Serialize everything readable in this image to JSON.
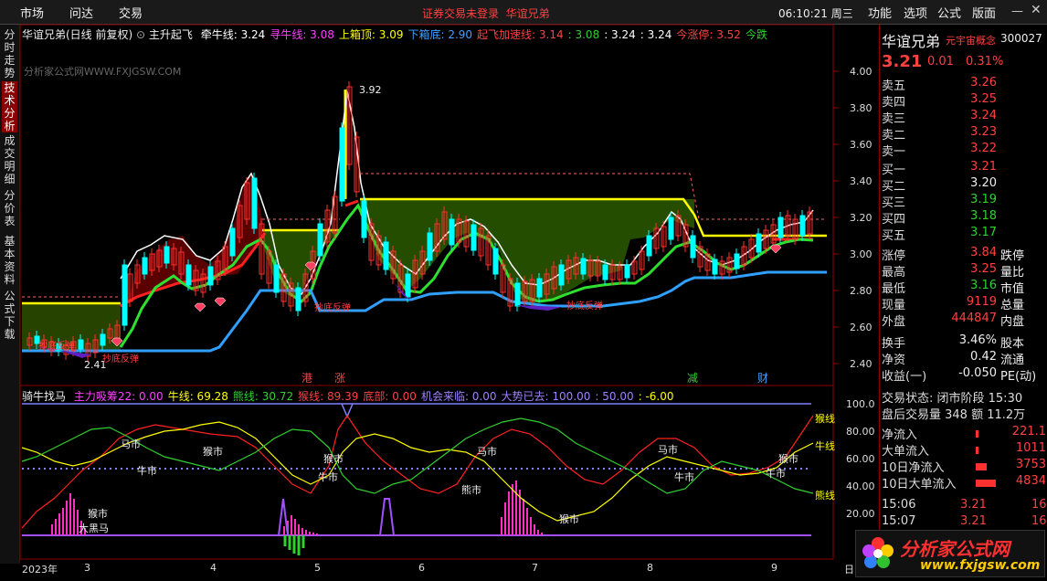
{
  "menu": {
    "items": [
      "市场",
      "问达",
      "交易"
    ],
    "right_items": [
      "功能",
      "选项",
      "公式",
      "版面"
    ],
    "warning": "证券交易未登录",
    "warning_name": "华谊兄弟",
    "clock": "06:10:21 周三"
  },
  "sidebar": {
    "tabs": [
      "分时走势",
      "技术分析",
      "成交明细",
      "分价表",
      "基本资料",
      "公式下载"
    ],
    "active": 1
  },
  "chart": {
    "stock_name": "华谊兄弟(日线 前复权)",
    "formula": "主升起飞",
    "labels": [
      {
        "t": "牵牛线: 3.24",
        "c": "#ffffff"
      },
      {
        "t": "寻牛线: 3.08",
        "c": "#ff40ff"
      },
      {
        "t": "上箱顶: 3.09",
        "c": "#ffff00"
      },
      {
        "t": "下箱底: 2.90",
        "c": "#40a0ff"
      },
      {
        "t": "起飞加速线: 3.14",
        "c": "#ff4040"
      },
      {
        "t": ": 3.08",
        "c": "#30d030"
      },
      {
        "t": ": 3.24",
        "c": "#ffffff"
      },
      {
        "t": ": 3.24",
        "c": "#ffffff"
      },
      {
        "t": "今涨停: 3.52",
        "c": "#ff4040"
      },
      {
        "t": "今跌",
        "c": "#30d030"
      }
    ],
    "watermark": "分析家公式网WWW.FXJGSW.COM",
    "price_ticks": [
      "4.00",
      "3.80",
      "3.60",
      "3.40",
      "3.20",
      "3.00",
      "2.80",
      "2.60",
      "2.40"
    ],
    "peak_label": "3.92",
    "low_label": "2.41",
    "annotations": [
      "抄底反弹",
      "抄底反弹",
      "抄底反弹",
      "抄底反弹"
    ],
    "event_marks": [
      {
        "t": "港",
        "c": "#ff4040"
      },
      {
        "t": "涨",
        "c": "#ff4040"
      },
      {
        "t": "减",
        "c": "#30d030"
      },
      {
        "t": "财",
        "c": "#40a0ff"
      }
    ]
  },
  "indicator": {
    "name": "骑牛找马",
    "labels": [
      {
        "t": "主力吸筹22: 0.00",
        "c": "#ff40ff"
      },
      {
        "t": "牛线: 69.28",
        "c": "#ffff00"
      },
      {
        "t": "熊线: 30.72",
        "c": "#30d030"
      },
      {
        "t": "猴线: 89.39",
        "c": "#ff4040"
      },
      {
        "t": "底部: 0.00",
        "c": "#ff4040"
      },
      {
        "t": "机会来临: 0.00",
        "c": "#a080ff"
      },
      {
        "t": "大势已去: 100.00",
        "c": "#a080ff"
      },
      {
        "t": ": 50.00",
        "c": "#a080ff"
      },
      {
        "t": ": -6.00",
        "c": "#ffff00"
      }
    ],
    "ticks": [
      "100.0",
      "80.00",
      "60.00",
      "40.00",
      "20.00"
    ],
    "right_tags": [
      {
        "t": "猴线",
        "c": "#ffff00"
      },
      {
        "t": "牛线",
        "c": "#ffff00"
      },
      {
        "t": "熊线",
        "c": "#ffff00"
      }
    ],
    "chart_labels": [
      "马市",
      "猴市",
      "牛市",
      "猴市",
      "牛市",
      "马市",
      "熊市",
      "马市",
      "牛市",
      "猴市",
      "牛市",
      "猴市",
      "大黑马",
      "猴市"
    ]
  },
  "xaxis": {
    "labels": [
      "2023年",
      "3",
      "4",
      "5",
      "6",
      "7",
      "8",
      "9",
      "日"
    ]
  },
  "quote": {
    "name": "华谊兄弟",
    "concept": "元宇宙概念",
    "code": "300027",
    "price": "3.21",
    "change": "0.01",
    "pct": "0.31%",
    "asks": [
      {
        "l": "卖五",
        "v": "3.26"
      },
      {
        "l": "卖四",
        "v": "3.25"
      },
      {
        "l": "卖三",
        "v": "3.24"
      },
      {
        "l": "卖二",
        "v": "3.23"
      },
      {
        "l": "卖一",
        "v": "3.22"
      }
    ],
    "bids": [
      {
        "l": "买一",
        "v": "3.21"
      },
      {
        "l": "买二",
        "v": "3.20"
      },
      {
        "l": "买三",
        "v": "3.19"
      },
      {
        "l": "买四",
        "v": "3.18"
      },
      {
        "l": "买五",
        "v": "3.17"
      }
    ],
    "stats": [
      {
        "l": "涨停",
        "v": "3.84",
        "r": "跌停"
      },
      {
        "l": "最高",
        "v": "3.25",
        "r": "量比"
      },
      {
        "l": "最低",
        "v": "3.16",
        "r": "市值"
      },
      {
        "l": "现量",
        "v": "9119",
        "r": "总量"
      },
      {
        "l": "外盘",
        "v": "444847",
        "r": "内盘"
      }
    ],
    "stats2": [
      {
        "l": "换手",
        "v": "3.46%",
        "r": "股本"
      },
      {
        "l": "净资",
        "v": "0.42",
        "r": "流通"
      },
      {
        "l": "收益(一)",
        "v": "-0.050",
        "r": "PE(动)"
      }
    ],
    "trade_state": "交易状态: 闭市阶段 15:30",
    "after_hours": "盘后交易量 348 额 11.2万",
    "flows": [
      {
        "l": "净流入",
        "v": "221.1"
      },
      {
        "l": "大单流入",
        "v": "1011"
      },
      {
        "l": "10日净流入",
        "v": "3753"
      },
      {
        "l": "10日大单流入",
        "v": "4834"
      }
    ],
    "ticks": [
      {
        "t": "15:06",
        "p": "3.21",
        "n": "16"
      },
      {
        "t": "15:07",
        "p": "3.21",
        "n": "16"
      }
    ]
  },
  "logo": {
    "text": "分析家公式网",
    "url": "www.fxjgsw.com"
  }
}
